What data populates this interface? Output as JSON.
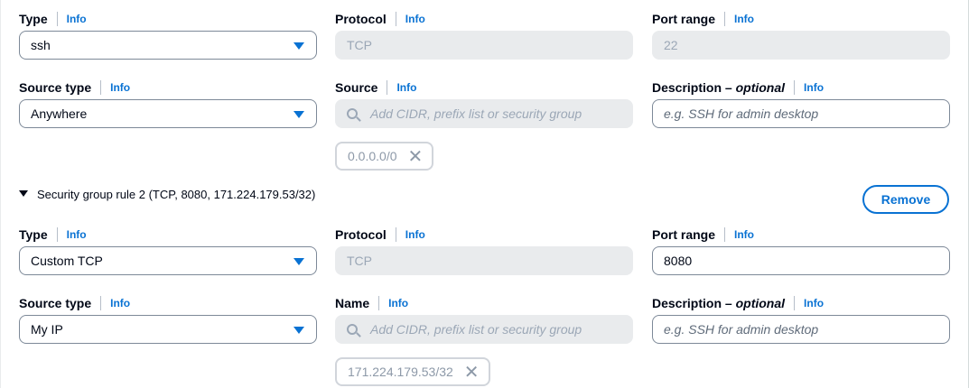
{
  "rule1": {
    "type": {
      "label": "Type",
      "info": "Info",
      "value": "ssh"
    },
    "protocol": {
      "label": "Protocol",
      "info": "Info",
      "value": "TCP"
    },
    "port_range": {
      "label": "Port range",
      "info": "Info",
      "value": "22"
    },
    "source_type": {
      "label": "Source type",
      "info": "Info",
      "value": "Anywhere"
    },
    "source": {
      "label": "Source",
      "info": "Info",
      "placeholder": "Add CIDR, prefix list or security group",
      "token": "0.0.0.0/0"
    },
    "description": {
      "label_main": "Description – ",
      "label_optional": "optional",
      "info": "Info",
      "placeholder": "e.g. SSH for admin desktop"
    }
  },
  "rule2": {
    "header": "Security group rule 2 (TCP, 8080, 171.224.179.53/32)",
    "remove_label": "Remove",
    "type": {
      "label": "Type",
      "info": "Info",
      "value": "Custom TCP"
    },
    "protocol": {
      "label": "Protocol",
      "info": "Info",
      "value": "TCP"
    },
    "port_range": {
      "label": "Port range",
      "info": "Info",
      "value": "8080"
    },
    "source_type": {
      "label": "Source type",
      "info": "Info",
      "value": "My IP"
    },
    "source": {
      "label": "Name",
      "info": "Info",
      "placeholder": "Add CIDR, prefix list or security group",
      "token": "171.224.179.53/32"
    },
    "description": {
      "label_main": "Description – ",
      "label_optional": "optional",
      "info": "Info",
      "placeholder": "e.g. SSH for admin desktop"
    }
  },
  "icons": {
    "caret": "caret-down-icon",
    "search": "search-icon",
    "dismiss": "close-icon",
    "expand": "triangle-down-icon"
  },
  "colors": {
    "link": "#0972d3",
    "text": "#000716",
    "disabled_bg": "#e9ebed",
    "border": "#7d8998"
  }
}
